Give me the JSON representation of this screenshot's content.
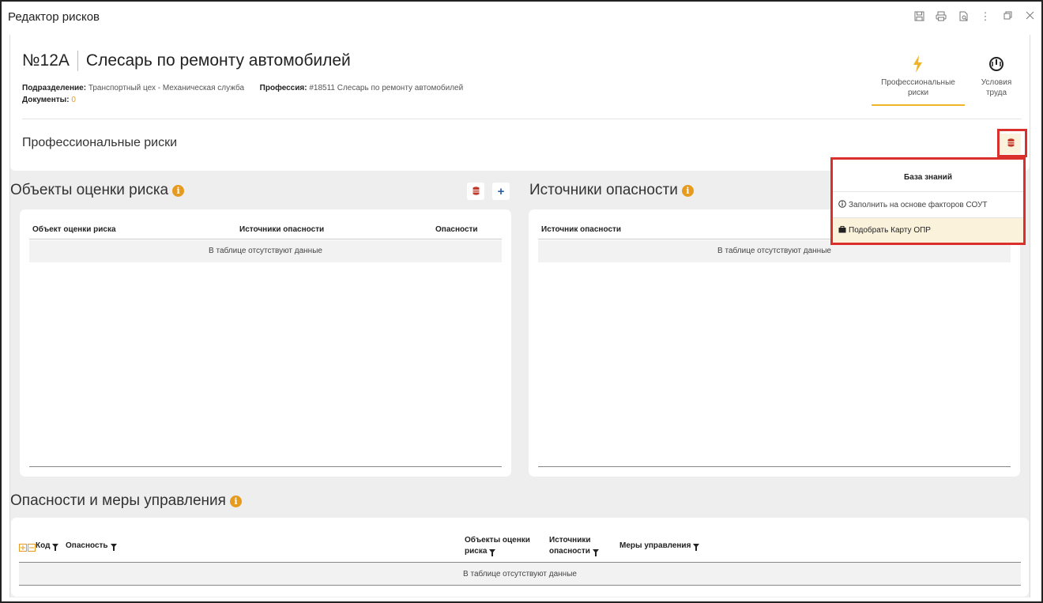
{
  "window": {
    "title": "Редактор рисков"
  },
  "header": {
    "number": "№12А",
    "profession_title": "Слесарь по ремонту автомобилей",
    "division_label": "Подразделение:",
    "division_value": "Транспортный цех - Механическая служба",
    "profession_label": "Профессия:",
    "profession_value": "#18511 Слесарь по ремонту автомобилей",
    "documents_label": "Документы:",
    "documents_value": "0"
  },
  "tabs": [
    {
      "label_line1": "Профессиональные",
      "label_line2": "риски",
      "icon": "lightning-icon",
      "active": true
    },
    {
      "label_line1": "Условия",
      "label_line2": "труда",
      "icon": "gauge-icon",
      "active": false
    }
  ],
  "section": {
    "title": "Профессиональные риски"
  },
  "risk_objects": {
    "title": "Объекты оценки риска",
    "columns": [
      "Объект оценки риска",
      "Источники опасности",
      "Опасности"
    ],
    "empty_text": "В таблице отсутствуют данные"
  },
  "hazard_sources": {
    "title": "Источники опасности",
    "columns": [
      "Источник опасности"
    ],
    "empty_text": "В таблице отсутствуют данные"
  },
  "dropdown": {
    "title": "База знаний",
    "item1": "Заполнить на основе факторов СОУТ",
    "item2": "Подобрать Карту ОПР"
  },
  "measures": {
    "title": "Опасности и меры управления",
    "col_code": "Код",
    "col_hazard": "Опасность",
    "col_objects_line1": "Объекты оценки",
    "col_objects_line2": "риска",
    "col_sources_line1": "Источники",
    "col_sources_line2": "опасности",
    "col_measures": "Меры управления",
    "empty_text": "В таблице отсутствуют данные"
  },
  "colors": {
    "accent_orange": "#e69b1f",
    "highlight_red": "#d9302c",
    "db_red": "#c0392b",
    "plus_blue": "#2a5ca8"
  }
}
